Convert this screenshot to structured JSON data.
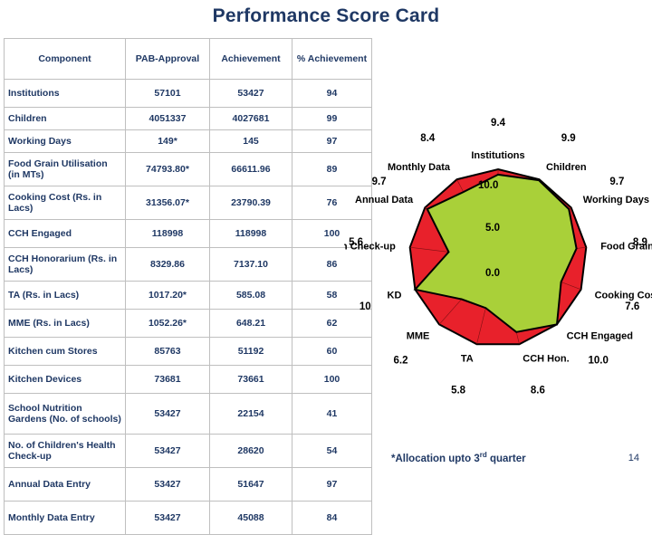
{
  "title": "Performance Score Card",
  "table": {
    "headers": [
      "Component",
      "PAB-Approval",
      "Achievement",
      "% Achievement"
    ],
    "rows": [
      {
        "component": "Institutions",
        "pab": "57101",
        "achievement": "53427",
        "pct": "94"
      },
      {
        "component": "Children",
        "pab": "4051337",
        "achievement": "4027681",
        "pct": "99"
      },
      {
        "component": "Working Days",
        "pab": "149*",
        "achievement": "145",
        "pct": "97"
      },
      {
        "component": "Food Grain Utilisation (in MTs)",
        "pab": "74793.80*",
        "achievement": "66611.96",
        "pct": "89"
      },
      {
        "component": "Cooking Cost    (Rs. in Lacs)",
        "pab": "31356.07*",
        "achievement": "23790.39",
        "pct": "76"
      },
      {
        "component": "CCH Engaged",
        "pab": "118998",
        "achievement": "118998",
        "pct": "100"
      },
      {
        "component": "CCH Honorarium (Rs. in Lacs)",
        "pab": "8329.86",
        "achievement": "7137.10",
        "pct": "86"
      },
      {
        "component": "TA (Rs. in Lacs)",
        "pab": "1017.20*",
        "achievement": "585.08",
        "pct": "58"
      },
      {
        "component": "MME (Rs. in Lacs)",
        "pab": "1052.26*",
        "achievement": "648.21",
        "pct": "62"
      },
      {
        "component": "Kitchen cum Stores",
        "pab": "85763",
        "achievement": "51192",
        "pct": "60"
      },
      {
        "component": "Kitchen Devices",
        "pab": "73681",
        "achievement": "73661",
        "pct": "100"
      },
      {
        "component": "School Nutrition Gardens (No. of schools)",
        "pab": "53427",
        "achievement": "22154",
        "pct": "41"
      },
      {
        "component": "No. of Children's Health Check-up",
        "pab": "53427",
        "achievement": "28620",
        "pct": "54"
      },
      {
        "component": "Annual Data Entry",
        "pab": "53427",
        "achievement": "51647",
        "pct": "97"
      },
      {
        "component": "Monthly Data Entry",
        "pab": "53427",
        "achievement": "45088",
        "pct": "84"
      }
    ]
  },
  "footnote": {
    "text_before": "*Allocation upto 3",
    "sup": "rd",
    "text_after": " quarter"
  },
  "page_number": "14",
  "chart_data": {
    "type": "radar",
    "categories": [
      "Institutions",
      "Children",
      "Working Days",
      "Food Grain",
      "Cooking Cost",
      "CCH Engaged",
      "CCH Hon.",
      "TA",
      "MME",
      "KD",
      "Health Check-up",
      "Annual Data",
      "Monthly Data"
    ],
    "values": [
      9.4,
      9.9,
      9.7,
      8.9,
      7.6,
      10.0,
      8.6,
      5.8,
      6.2,
      10.0,
      5.6,
      9.7,
      8.4
    ],
    "value_labels": [
      "9.4",
      "9.9",
      "9.7",
      "8.9",
      "7.6",
      "10.0",
      "8.6",
      "5.8",
      "6.2",
      "10",
      "5.6",
      "9.7",
      "8.4"
    ],
    "radial_ticks": [
      "0.0",
      "5.0",
      "10.0"
    ],
    "rlim": [
      0,
      10
    ],
    "series_color": "#A9D039",
    "background_color": "#E8212B",
    "outline_color": "#000000",
    "title": "",
    "legend": []
  }
}
